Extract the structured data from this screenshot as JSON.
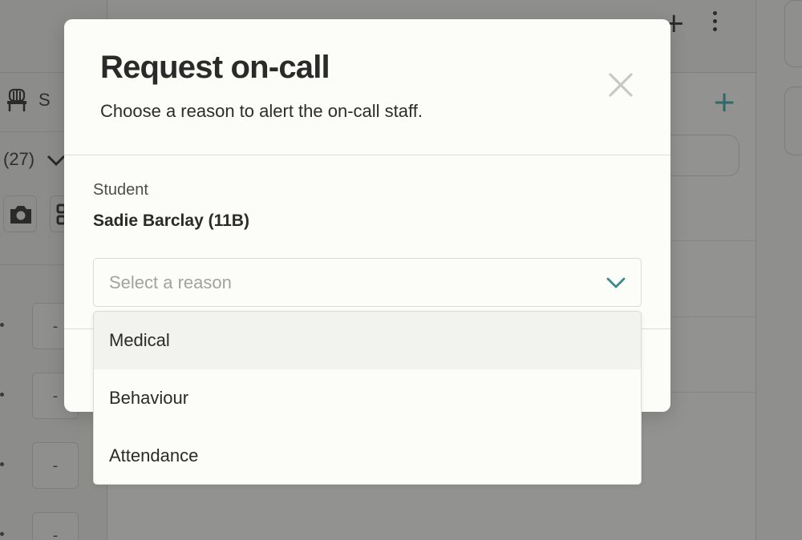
{
  "background": {
    "left_letter": "S",
    "left_count": "(27)",
    "dash_value": "-",
    "accent_color": "#3c8a8a"
  },
  "modal": {
    "title": "Request on-call",
    "subtitle": "Choose a reason to alert the on-call staff.",
    "close_icon": "close-icon",
    "student_label": "Student",
    "student_value": "Sadie Barclay (11B)",
    "reason_select": {
      "placeholder": "Select a reason",
      "chevron_icon": "chevron-down-icon",
      "chevron_color": "#3c8a8a",
      "options": [
        "Medical",
        "Behaviour",
        "Attendance"
      ],
      "highlighted": "Medical"
    }
  }
}
